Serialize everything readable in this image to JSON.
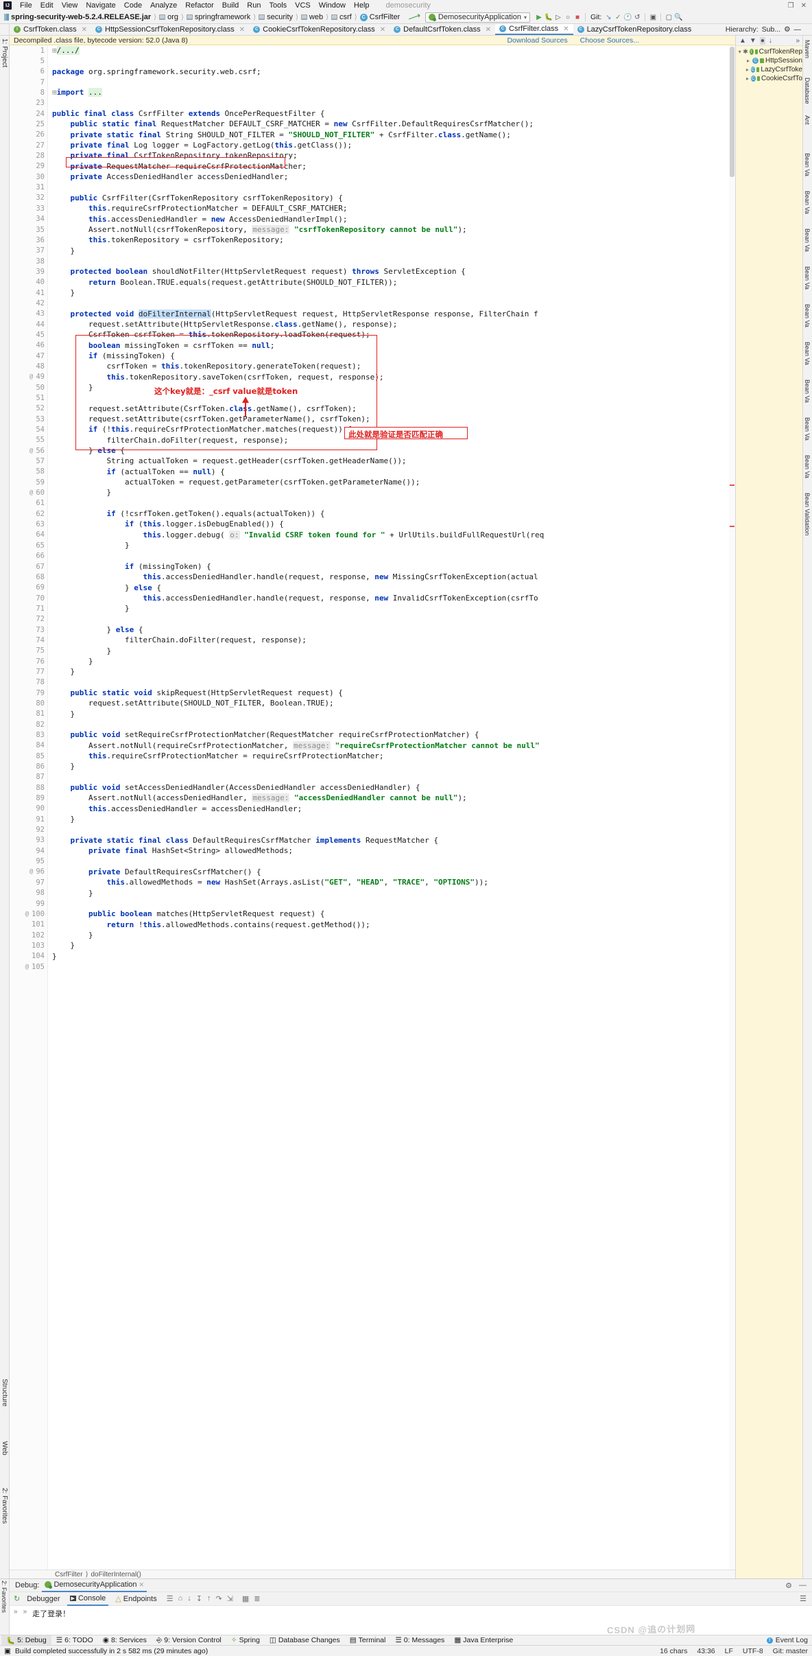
{
  "window": {
    "project_name": "demosecurity",
    "ide": "IntelliJ IDEA"
  },
  "menubar": {
    "logo": "IJ",
    "items": [
      "File",
      "Edit",
      "View",
      "Navigate",
      "Code",
      "Analyze",
      "Refactor",
      "Build",
      "Run",
      "Tools",
      "VCS",
      "Window",
      "Help"
    ]
  },
  "breadcrumb": {
    "items": [
      {
        "label": "spring-security-web-5.2.4.RELEASE.jar",
        "icon": "jar-icon",
        "bold": true
      },
      {
        "label": "org",
        "icon": "folder-icon"
      },
      {
        "label": "springframework",
        "icon": "folder-icon"
      },
      {
        "label": "security",
        "icon": "folder-icon"
      },
      {
        "label": "web",
        "icon": "folder-icon"
      },
      {
        "label": "csrf",
        "icon": "folder-icon"
      },
      {
        "label": "CsrfFilter",
        "icon": "class-icon"
      }
    ]
  },
  "toolbar": {
    "run_configuration": "DemosecurityApplication",
    "git_label": "Git:",
    "icons": [
      "run-icon",
      "debug-icon",
      "run-with-coverage-icon",
      "profile-icon",
      "stop-icon",
      "update-project-icon",
      "commit-icon",
      "history-icon",
      "rollback-icon",
      "run-anything-icon",
      "open-terminal-icon",
      "search-everywhere-icon"
    ]
  },
  "editor_tabs": [
    {
      "label": "CsrfToken.class",
      "icon": "interface-icon",
      "active": false
    },
    {
      "label": "HttpSessionCsrfTokenRepository.class",
      "icon": "class-icon",
      "active": false
    },
    {
      "label": "CookieCsrfTokenRepository.class",
      "icon": "class-icon",
      "active": false
    },
    {
      "label": "DefaultCsrfToken.class",
      "icon": "class-icon",
      "active": false
    },
    {
      "label": "CsrfFilter.class",
      "icon": "class-icon",
      "active": true
    },
    {
      "label": "LazyCsrfTokenRepository.class",
      "icon": "class-icon",
      "active": false
    }
  ],
  "notification": {
    "message": "Decompiled .class file, bytecode version: 52.0 (Java 8)",
    "download_sources": "Download Sources",
    "choose_sources": "Choose Sources..."
  },
  "hierarchy": {
    "title": "Hierarchy:",
    "scope": "Sub...",
    "nodes": [
      {
        "label": "CsrfTokenRep",
        "icon": "interface-icon",
        "indent": 0,
        "chev": "v"
      },
      {
        "label": "HttpSession",
        "icon": "class-icon",
        "indent": 1,
        "chev": ">"
      },
      {
        "label": "LazyCsrfToke",
        "icon": "class-icon",
        "indent": 1,
        "chev": ">"
      },
      {
        "label": "CookieCsrfTo",
        "icon": "class-icon",
        "indent": 1,
        "chev": ">"
      }
    ]
  },
  "right_strip": {
    "labels": [
      "Maven",
      "Database",
      "Ant",
      "Bean Va",
      "Bean Va",
      "Bean Va",
      "Bean Va",
      "Bean Va",
      "Bean Va",
      "Bean Va",
      "Bean Va",
      "Bean Va",
      "Bean Validation"
    ]
  },
  "left_strip": {
    "labels": [
      "1: Project",
      "Structure",
      "Web",
      "2: Favorites"
    ]
  },
  "editor_breadcrumb": {
    "class": "CsrfFilter",
    "method": "doFilterInternal()"
  },
  "gutter": {
    "line_numbers": [
      "1",
      "5",
      "6",
      "7",
      "8",
      "23",
      "24",
      "25",
      "26",
      "27",
      "28",
      "29",
      "30",
      "31",
      "32",
      "33",
      "34",
      "35",
      "36",
      "37",
      "38",
      "39",
      "40",
      "41",
      "42",
      "43",
      "44",
      "45",
      "46",
      "47",
      "48",
      "49",
      "50",
      "51",
      "52",
      "53",
      "54",
      "55",
      "56",
      "57",
      "58",
      "59",
      "60",
      "61",
      "62",
      "63",
      "64",
      "65",
      "66",
      "67",
      "68",
      "69",
      "70",
      "71",
      "72",
      "73",
      "74",
      "75",
      "76",
      "77",
      "78",
      "79",
      "80",
      "81",
      "82",
      "83",
      "84",
      "85",
      "86",
      "87",
      "88",
      "89",
      "90",
      "91",
      "92",
      "93",
      "94",
      "95",
      "96",
      "97",
      "98",
      "99",
      "100",
      "101",
      "102",
      "103",
      "104",
      "105"
    ]
  },
  "code_lines": [
    "/.../",
    "",
    "package org.springframework.security.web.csrf;",
    "",
    "import ...",
    "",
    "public final class CsrfFilter extends OncePerRequestFilter {",
    "    public static final RequestMatcher DEFAULT_CSRF_MATCHER = new CsrfFilter.DefaultRequiresCsrfMatcher();",
    "    private static final String SHOULD_NOT_FILTER = \"SHOULD_NOT_FILTER\" + CsrfFilter.class.getName();",
    "    private final Log logger = LogFactory.getLog(this.getClass());",
    "    private final CsrfTokenRepository tokenRepository;",
    "    private RequestMatcher requireCsrfProtectionMatcher;",
    "    private AccessDeniedHandler accessDeniedHandler;",
    "",
    "    public CsrfFilter(CsrfTokenRepository csrfTokenRepository) {",
    "        this.requireCsrfProtectionMatcher = DEFAULT_CSRF_MATCHER;",
    "        this.accessDeniedHandler = new AccessDeniedHandlerImpl();",
    "        Assert.notNull(csrfTokenRepository,  message: \"csrfTokenRepository cannot be null\");",
    "        this.tokenRepository = csrfTokenRepository;",
    "    }",
    "",
    "    protected boolean shouldNotFilter(HttpServletRequest request) throws ServletException {",
    "        return Boolean.TRUE.equals(request.getAttribute(SHOULD_NOT_FILTER));",
    "    }",
    "",
    "    protected void doFilterInternal(HttpServletRequest request, HttpServletResponse response, FilterChain f",
    "        request.setAttribute(HttpServletResponse.class.getName(), response);",
    "        CsrfToken csrfToken = this.tokenRepository.loadToken(request);",
    "        boolean missingToken = csrfToken == null;",
    "        if (missingToken) {",
    "            csrfToken = this.tokenRepository.generateToken(request);",
    "            this.tokenRepository.saveToken(csrfToken, request, response);",
    "        }",
    "",
    "        request.setAttribute(CsrfToken.class.getName(), csrfToken);",
    "        request.setAttribute(csrfToken.getParameterName(), csrfToken);",
    "        if (!this.requireCsrfProtectionMatcher.matches(request)) {",
    "            filterChain.doFilter(request, response);",
    "        } else {",
    "            String actualToken = request.getHeader(csrfToken.getHeaderName());",
    "            if (actualToken == null) {",
    "                actualToken = request.getParameter(csrfToken.getParameterName());",
    "            }",
    "",
    "            if (!csrfToken.getToken().equals(actualToken)) {",
    "                if (this.logger.isDebugEnabled()) {",
    "                    this.logger.debug( o: \"Invalid CSRF token found for \" + UrlUtils.buildFullRequestUrl(req",
    "                }",
    "",
    "                if (missingToken) {",
    "                    this.accessDeniedHandler.handle(request, response, new MissingCsrfTokenException(actual",
    "                } else {",
    "                    this.accessDeniedHandler.handle(request, response, new InvalidCsrfTokenException(csrfTo",
    "                }",
    "",
    "            } else {",
    "                filterChain.doFilter(request, response);",
    "            }",
    "        }",
    "    }",
    "",
    "    public static void skipRequest(HttpServletRequest request) {",
    "        request.setAttribute(SHOULD_NOT_FILTER, Boolean.TRUE);",
    "    }",
    "",
    "    public void setRequireCsrfProtectionMatcher(RequestMatcher requireCsrfProtectionMatcher) {",
    "        Assert.notNull(requireCsrfProtectionMatcher,  message: \"requireCsrfProtectionMatcher cannot be null\"",
    "        this.requireCsrfProtectionMatcher = requireCsrfProtectionMatcher;",
    "    }",
    "",
    "    public void setAccessDeniedHandler(AccessDeniedHandler accessDeniedHandler) {",
    "        Assert.notNull(accessDeniedHandler,  message: \"accessDeniedHandler cannot be null\");",
    "        this.accessDeniedHandler = accessDeniedHandler;",
    "    }",
    "",
    "    private static final class DefaultRequiresCsrfMatcher implements RequestMatcher {",
    "        private final HashSet<String> allowedMethods;",
    "",
    "        private DefaultRequiresCsrfMatcher() {",
    "            this.allowedMethods = new HashSet(Arrays.asList(\"GET\", \"HEAD\", \"TRACE\", \"OPTIONS\"));",
    "        }",
    "",
    "        public boolean matches(HttpServletRequest request) {",
    "            return !this.allowedMethods.contains(request.getMethod());",
    "        }",
    "    }",
    "}",
    ""
  ],
  "annotations": {
    "key_value_note": "这个key就是：_csrf  value就是token",
    "key_token": "_csrf",
    "match_note": "此处就是验证是否匹配正确"
  },
  "debug_panel": {
    "title": "Debug:",
    "config_name": "DemosecurityApplication",
    "tabs": [
      {
        "label": "Debugger",
        "icon": "debugger-icon",
        "active": false
      },
      {
        "label": "Console",
        "icon": "console-icon",
        "active": true
      },
      {
        "label": "Endpoints",
        "icon": "endpoints-icon",
        "active": false
      }
    ],
    "console_text": "走了登录！"
  },
  "toolwindow_bar": {
    "items": [
      {
        "label": "5: Debug",
        "icon": "debug-icon",
        "active": true
      },
      {
        "label": "6: TODO",
        "icon": "todo-icon",
        "active": false
      },
      {
        "label": "8: Services",
        "icon": "services-icon",
        "active": false
      },
      {
        "label": "9: Version Control",
        "icon": "vcs-icon",
        "active": false
      },
      {
        "label": "Spring",
        "icon": "spring-icon",
        "active": false
      },
      {
        "label": "Database Changes",
        "icon": "database-icon",
        "active": false
      },
      {
        "label": "Terminal",
        "icon": "terminal-icon",
        "active": false
      },
      {
        "label": "0: Messages",
        "icon": "messages-icon",
        "active": false
      },
      {
        "label": "Java Enterprise",
        "icon": "java-ee-icon",
        "active": false
      }
    ],
    "event_log": "Event Log"
  },
  "status_bar": {
    "message": "Build completed successfully in 2 s 582 ms (29 minutes ago)",
    "chars": "16 chars",
    "caret": "43:36",
    "line_separator": "LF",
    "encoding": "UTF-8",
    "branch": "Git: master"
  },
  "watermark": "CSDN @追の计划网"
}
